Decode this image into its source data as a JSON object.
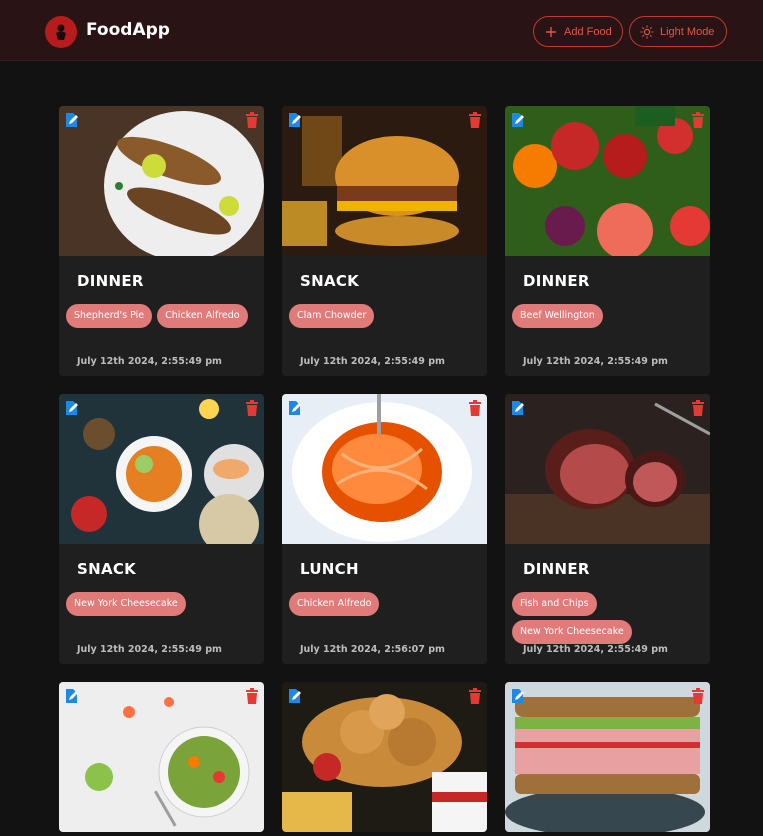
{
  "app": {
    "brand": "FoodApp",
    "add_food_label": "Add Food",
    "light_mode_label": "Light Mode"
  },
  "colors": {
    "accent": "#c0392b",
    "chip": "#e07b79",
    "card_bg": "#1f1f1f",
    "page_bg": "#121212",
    "nav_bg": "#2a1314",
    "edit_icon": "#1e88e5",
    "delete_icon": "#e53935"
  },
  "icons": {
    "logo": "chef-logo-icon",
    "add": "plus-icon",
    "light": "sun-icon",
    "edit": "edit-icon",
    "delete": "trash-icon"
  },
  "cards": [
    {
      "type": "DINNER",
      "foods": [
        "Shepherd's Pie",
        "Chicken Alfredo"
      ],
      "date": "July 12th 2024, 2:55:49 pm",
      "image": "grilled fish"
    },
    {
      "type": "SNACK",
      "foods": [
        "Clam Chowder"
      ],
      "date": "July 12th 2024, 2:55:49 pm",
      "image": "burger and fries"
    },
    {
      "type": "DINNER",
      "foods": [
        "Beef Wellington"
      ],
      "date": "July 12th 2024, 2:55:49 pm",
      "image": "fresh vegetables"
    },
    {
      "type": "SNACK",
      "foods": [
        "New York Cheesecake"
      ],
      "date": "July 12th 2024, 2:55:49 pm",
      "image": "food spread"
    },
    {
      "type": "LUNCH",
      "foods": [
        "Chicken Alfredo"
      ],
      "date": "July 12th 2024, 2:56:07 pm",
      "image": "spaghetti"
    },
    {
      "type": "DINNER",
      "foods": [
        "Fish and Chips",
        "New York Cheesecake"
      ],
      "date": "July 12th 2024, 2:55:49 pm",
      "image": "steak"
    },
    {
      "type": "",
      "foods": [],
      "date": "",
      "image": "salad bowl"
    },
    {
      "type": "",
      "foods": [],
      "date": "",
      "image": "fried chicken"
    },
    {
      "type": "",
      "foods": [],
      "date": "",
      "image": "sandwich"
    }
  ]
}
